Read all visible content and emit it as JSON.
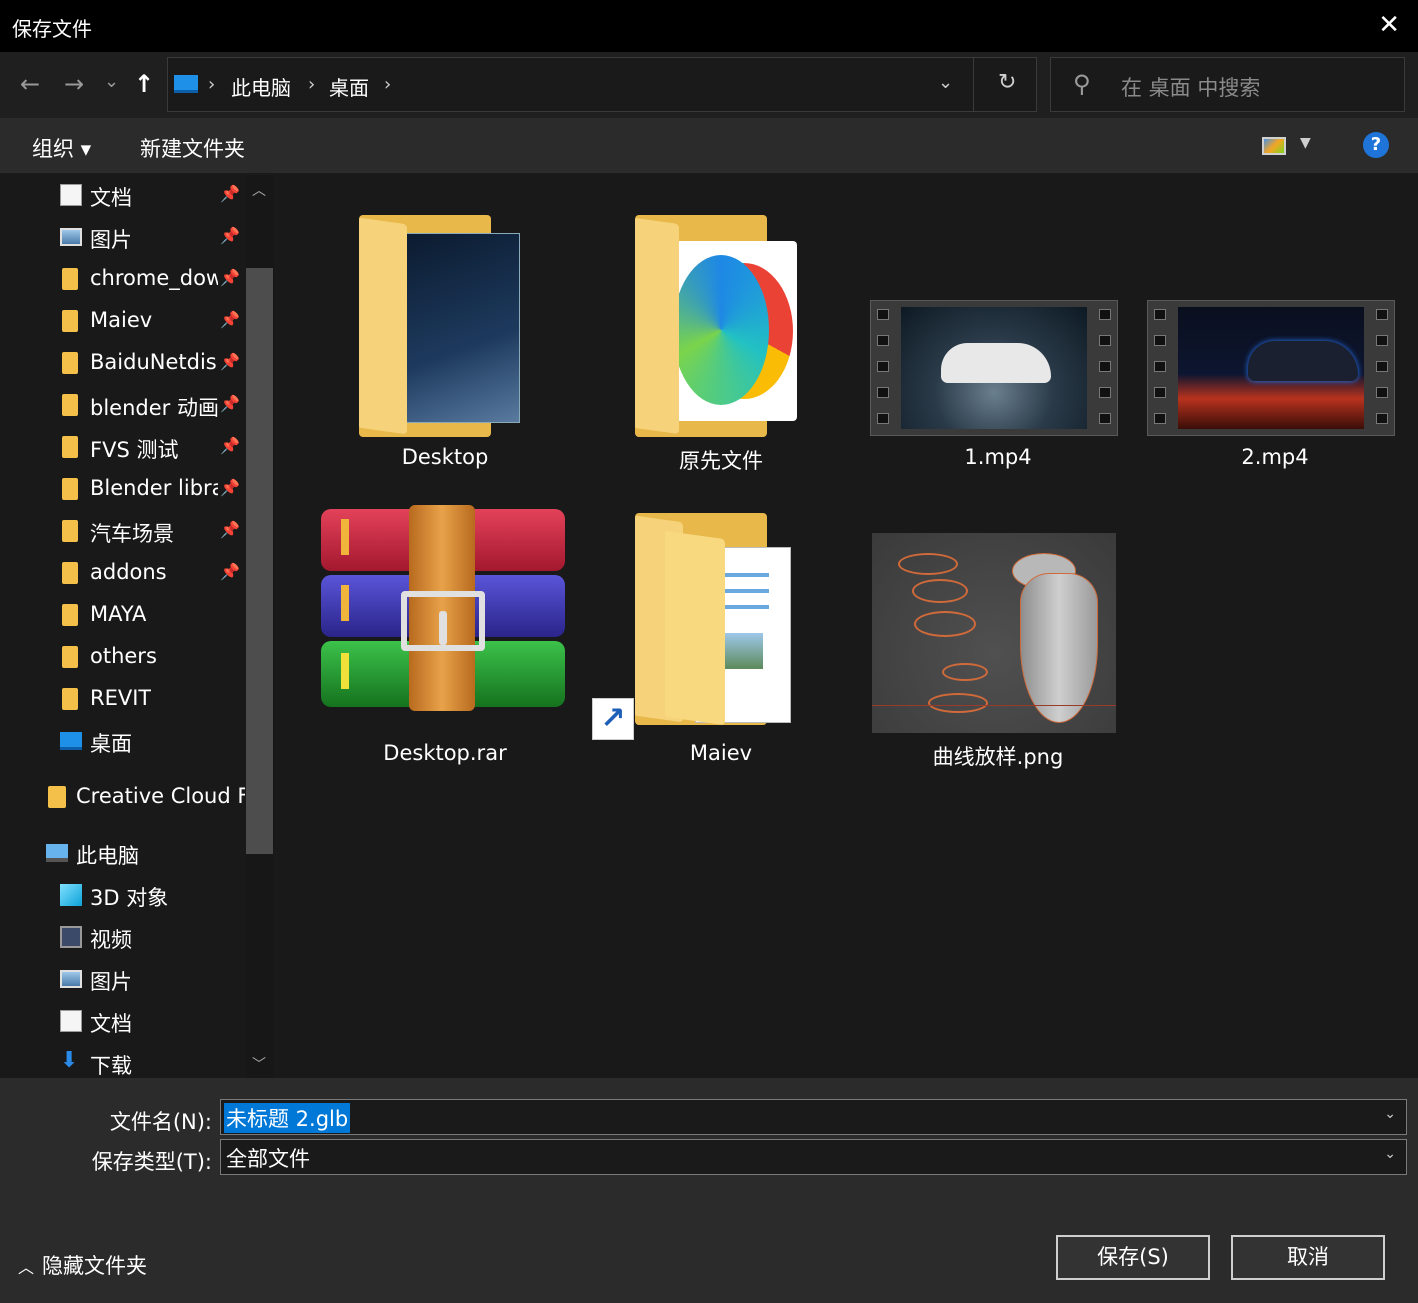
{
  "window": {
    "title": "保存文件",
    "close_glyph": "✕"
  },
  "nav": {
    "back_glyph": "←",
    "forward_glyph": "→",
    "recent_glyph": "⌄",
    "up_glyph": "↑",
    "breadcrumb": [
      "此电脑",
      "桌面"
    ],
    "refresh_glyph": "↻",
    "search_placeholder": "在 桌面 中搜索"
  },
  "toolbar": {
    "organize": "组织 ▾",
    "new_folder": "新建文件夹",
    "help": "?"
  },
  "sidebar": {
    "quick_access": [
      {
        "label": "文档",
        "icon": "document-icon",
        "pinned": true
      },
      {
        "label": "图片",
        "icon": "picture-icon",
        "pinned": true
      },
      {
        "label": "chrome_dow",
        "icon": "folder-icon",
        "pinned": true
      },
      {
        "label": "Maiev",
        "icon": "folder-icon",
        "pinned": true
      },
      {
        "label": "BaiduNetdisl",
        "icon": "folder-icon",
        "pinned": true
      },
      {
        "label": "blender 动画",
        "icon": "folder-icon",
        "pinned": true
      },
      {
        "label": "FVS 测试",
        "icon": "folder-icon",
        "pinned": true
      },
      {
        "label": "Blender libra",
        "icon": "folder-icon",
        "pinned": true
      },
      {
        "label": "汽车场景",
        "icon": "folder-icon",
        "pinned": true
      },
      {
        "label": "addons",
        "icon": "folder-icon",
        "pinned": true
      },
      {
        "label": "MAYA",
        "icon": "folder-icon",
        "pinned": false
      },
      {
        "label": "others",
        "icon": "folder-icon",
        "pinned": false
      },
      {
        "label": "REVIT",
        "icon": "folder-icon",
        "pinned": false
      },
      {
        "label": "桌面",
        "icon": "desktop-icon",
        "pinned": false
      }
    ],
    "creative_cloud": "Creative Cloud Fi",
    "this_pc": "此电脑",
    "pc_items": [
      {
        "label": "3D 对象",
        "icon": "3d-objects-icon"
      },
      {
        "label": "视频",
        "icon": "video-icon"
      },
      {
        "label": "图片",
        "icon": "picture-icon"
      },
      {
        "label": "文档",
        "icon": "document-icon"
      },
      {
        "label": "下载",
        "icon": "download-icon"
      }
    ]
  },
  "files": [
    {
      "name": "Desktop",
      "type": "folder"
    },
    {
      "name": "原先文件",
      "type": "folder"
    },
    {
      "name": "1.mp4",
      "type": "video"
    },
    {
      "name": "2.mp4",
      "type": "video"
    },
    {
      "name": "Desktop.rar",
      "type": "archive"
    },
    {
      "name": "Maiev",
      "type": "folder-shortcut"
    },
    {
      "name": "曲线放样.png",
      "type": "image"
    }
  ],
  "bottom": {
    "filename_label": "文件名(N):",
    "filename_value": "未标题 2.glb",
    "filetype_label": "保存类型(T):",
    "filetype_value": "全部文件",
    "hide_folders": "隐藏文件夹",
    "save_button": "保存(S)",
    "cancel_button": "取消"
  }
}
